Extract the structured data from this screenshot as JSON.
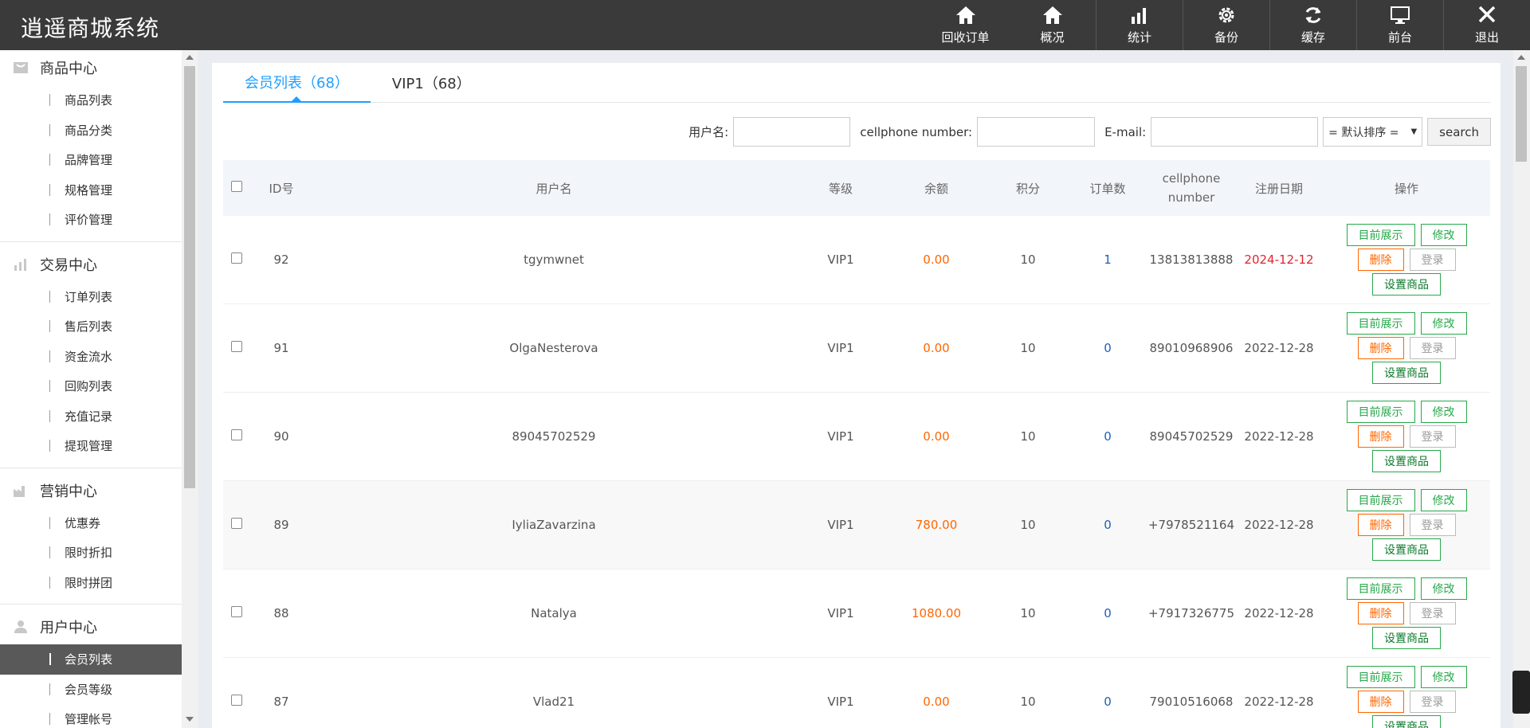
{
  "app": {
    "title": "逍遥商城系统"
  },
  "topnav": [
    {
      "label": "回收订单",
      "icon": "home-icon"
    },
    {
      "label": "概况",
      "icon": "home-icon"
    },
    {
      "label": "统计",
      "icon": "bar-chart-icon"
    },
    {
      "label": "备份",
      "icon": "gear-icon"
    },
    {
      "label": "缓存",
      "icon": "refresh-icon"
    },
    {
      "label": "前台",
      "icon": "monitor-icon"
    },
    {
      "label": "退出",
      "icon": "close-icon"
    }
  ],
  "sidebar": {
    "groups": [
      {
        "title": "商品中心",
        "icon": "cart-icon",
        "items": [
          "商品列表",
          "商品分类",
          "品牌管理",
          "规格管理",
          "评价管理"
        ]
      },
      {
        "title": "交易中心",
        "icon": "bar-chart-icon",
        "items": [
          "订单列表",
          "售后列表",
          "资金流水",
          "回购列表",
          "充值记录",
          "提现管理"
        ]
      },
      {
        "title": "营销中心",
        "icon": "factory-icon",
        "items": [
          "优惠券",
          "限时折扣",
          "限时拼团"
        ]
      },
      {
        "title": "用户中心",
        "icon": "user-icon",
        "items": [
          "会员列表",
          "会员等级",
          "管理帐号"
        ]
      }
    ],
    "active_item": "会员列表"
  },
  "tabs": [
    {
      "label": "会员列表（68）",
      "active": true
    },
    {
      "label": "VIP1（68）",
      "active": false
    }
  ],
  "filters": {
    "username_label": "用户名:",
    "username_value": "",
    "phone_label": "cellphone number:",
    "phone_value": "",
    "email_label": "E-mail:",
    "email_value": "",
    "sort_selected": "= 默认排序 =",
    "search_label": "search"
  },
  "table": {
    "headers": {
      "id": "ID号",
      "name": "用户名",
      "level": "等级",
      "balance": "余额",
      "points": "积分",
      "orders": "订单数",
      "phone_line1": "cellphone",
      "phone_line2": "number",
      "date": "注册日期",
      "ops": "操作"
    },
    "actions": {
      "show": "目前展示",
      "edit": "修改",
      "delete": "删除",
      "login": "登录",
      "set_goods": "设置商品"
    },
    "rows": [
      {
        "id": "92",
        "name": "tgymwnet",
        "level": "VIP1",
        "balance": "0.00",
        "points": "10",
        "orders": "1",
        "phone": "13813813888",
        "date": "2024-12-12"
      },
      {
        "id": "91",
        "name": "OlgaNesterova",
        "level": "VIP1",
        "balance": "0.00",
        "points": "10",
        "orders": "0",
        "phone": "89010968906",
        "date": "2022-12-28"
      },
      {
        "id": "90",
        "name": "89045702529",
        "level": "VIP1",
        "balance": "0.00",
        "points": "10",
        "orders": "0",
        "phone": "89045702529",
        "date": "2022-12-28"
      },
      {
        "id": "89",
        "name": "IyliaZavarzina",
        "level": "VIP1",
        "balance": "780.00",
        "points": "10",
        "orders": "0",
        "phone": "+7978521164",
        "date": "2022-12-28"
      },
      {
        "id": "88",
        "name": "Natalya",
        "level": "VIP1",
        "balance": "1080.00",
        "points": "10",
        "orders": "0",
        "phone": "+7917326775",
        "date": "2022-12-28"
      },
      {
        "id": "87",
        "name": "Vlad21",
        "level": "VIP1",
        "balance": "0.00",
        "points": "10",
        "orders": "0",
        "phone": "79010516068",
        "date": "2022-12-28"
      }
    ]
  }
}
